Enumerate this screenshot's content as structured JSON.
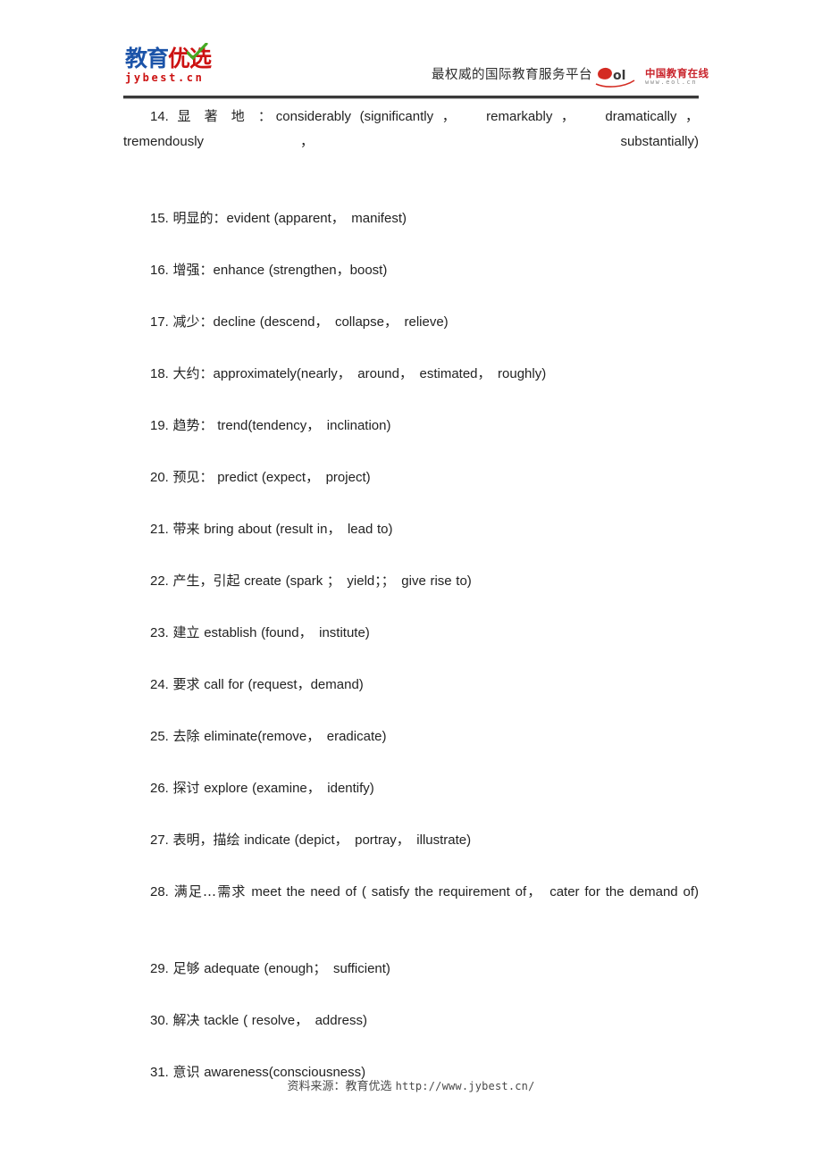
{
  "header": {
    "logo_left": {
      "text_blue": "教育",
      "text_red": "优选",
      "domain": "jybest.cn",
      "check_icon": "green-check-icon",
      "color_blue": "#1b53a8",
      "color_red": "#cc1111",
      "color_check": "#44aa22"
    },
    "slogan": "最权威的国际教育服务平台",
    "logo_right": {
      "mark": "eol",
      "name_cn": "中国教育在线",
      "url": "www.eol.cn",
      "color_red": "#c9232b"
    }
  },
  "entries": [
    {
      "number": "14.",
      "term": "显 著 地 ：",
      "body": "considerably (significantly ， 　remarkably ， 　dramatically ， tremendously， 　substantially)",
      "indent": true,
      "multiline": true
    },
    {
      "number": "15.",
      "term": "明显的：",
      "body": "evident (apparent，　manifest)",
      "indent": true,
      "multiline": false
    },
    {
      "number": "16.",
      "term": "增强：",
      "body": "enhance (strengthen，boost)",
      "indent": true,
      "multiline": false
    },
    {
      "number": "17.",
      "term": "减少：",
      "body": "decline (descend，　collapse，　relieve)",
      "indent": true,
      "multiline": false
    },
    {
      "number": "18.",
      "term": "大约：",
      "body": "approximately(nearly，　around，　estimated，　roughly)",
      "indent": true,
      "multiline": false
    },
    {
      "number": "19.",
      "term": "趋势：",
      "body": " trend(tendency，　inclination)",
      "indent": true,
      "multiline": false
    },
    {
      "number": "20.",
      "term": "预见：",
      "body": " predict (expect，　project)",
      "indent": true,
      "multiline": false
    },
    {
      "number": "21.",
      "term": "带来",
      "body": " bring about (result in，　lead to)",
      "indent": true,
      "multiline": false
    },
    {
      "number": "22.",
      "term": "产生，引起",
      "body": " create (spark ；　yield；；　give rise to)",
      "indent": true,
      "multiline": false
    },
    {
      "number": "23.",
      "term": "建立",
      "body": " establish (found，　institute)",
      "indent": true,
      "multiline": false
    },
    {
      "number": "24.",
      "term": "要求",
      "body": " call for (request，demand)",
      "indent": true,
      "multiline": false
    },
    {
      "number": "25.",
      "term": "去除",
      "body": " eliminate(remove，　eradicate)",
      "indent": true,
      "multiline": false
    },
    {
      "number": "26.",
      "term": "探讨",
      "body": " explore (examine，　identify)",
      "indent": true,
      "multiline": false
    },
    {
      "number": "27.",
      "term": "表明，描绘",
      "body": " indicate (depict，　portray，　illustrate)",
      "indent": true,
      "multiline": false
    },
    {
      "number": "28.",
      "term": "满足…需求",
      "body": " meet the need of ( satisfy the requirement of，　cater for the demand of)",
      "indent": true,
      "multiline": true
    },
    {
      "number": "29.",
      "term": "足够",
      "body": " adequate (enough；　sufficient)",
      "indent": true,
      "multiline": false
    },
    {
      "number": "30.",
      "term": "解决",
      "body": " tackle ( resolve，　address)",
      "indent": true,
      "multiline": false
    },
    {
      "number": "31.",
      "term": "意识",
      "body": " awareness(consciousness)",
      "indent": true,
      "multiline": false
    }
  ],
  "footer": {
    "source_label": "资料来源：教育优选 ",
    "url": "http://www.jybest.cn/"
  }
}
